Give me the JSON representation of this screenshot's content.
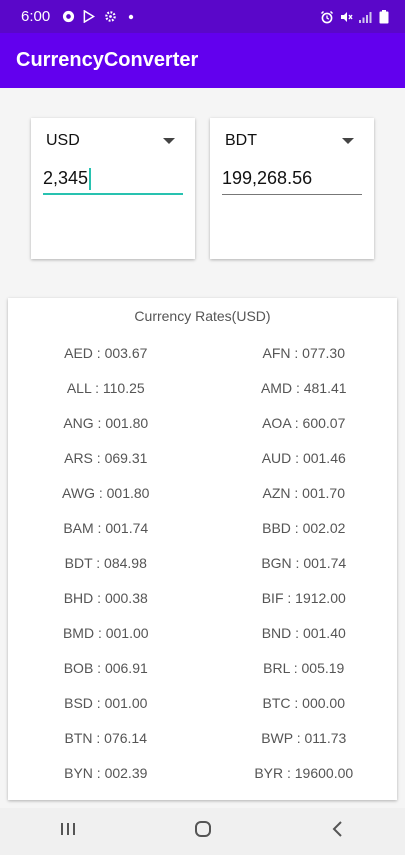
{
  "status_bar": {
    "time": "6:00",
    "left_icons": [
      "chrome-icon",
      "play-store-icon",
      "settings-icon",
      "dot-icon"
    ],
    "right_icons": [
      "alarm-icon",
      "mute-icon",
      "signal-icon",
      "battery-icon"
    ]
  },
  "app_bar": {
    "title": "CurrencyConverter"
  },
  "converter": {
    "from": {
      "currency": "USD",
      "amount": "2,345"
    },
    "to": {
      "currency": "BDT",
      "amount": "199,268.56"
    }
  },
  "rates": {
    "title": "Currency Rates(USD)",
    "rows": [
      {
        "left": "AED : 003.67",
        "right": "AFN : 077.30"
      },
      {
        "left": "ALL : 110.25",
        "right": "AMD : 481.41"
      },
      {
        "left": "ANG : 001.80",
        "right": "AOA : 600.07"
      },
      {
        "left": "ARS : 069.31",
        "right": "AUD : 001.46"
      },
      {
        "left": "AWG : 001.80",
        "right": "AZN : 001.70"
      },
      {
        "left": "BAM : 001.74",
        "right": "BBD : 002.02"
      },
      {
        "left": "BDT : 084.98",
        "right": "BGN : 001.74"
      },
      {
        "left": "BHD : 000.38",
        "right": "BIF : 1912.00"
      },
      {
        "left": "BMD : 001.00",
        "right": "BND : 001.40"
      },
      {
        "left": "BOB : 006.91",
        "right": "BRL : 005.19"
      },
      {
        "left": "BSD : 001.00",
        "right": "BTC : 000.00"
      },
      {
        "left": "BTN : 076.14",
        "right": "BWP : 011.73"
      },
      {
        "left": "BYN : 002.39",
        "right": "BYR : 19600.00"
      }
    ]
  },
  "nav_bar": {
    "buttons": [
      "recents-icon",
      "home-icon",
      "back-icon"
    ]
  },
  "colors": {
    "status_bar": "#5a07c9",
    "app_bar": "#6200ee",
    "accent": "#28c2b0"
  }
}
